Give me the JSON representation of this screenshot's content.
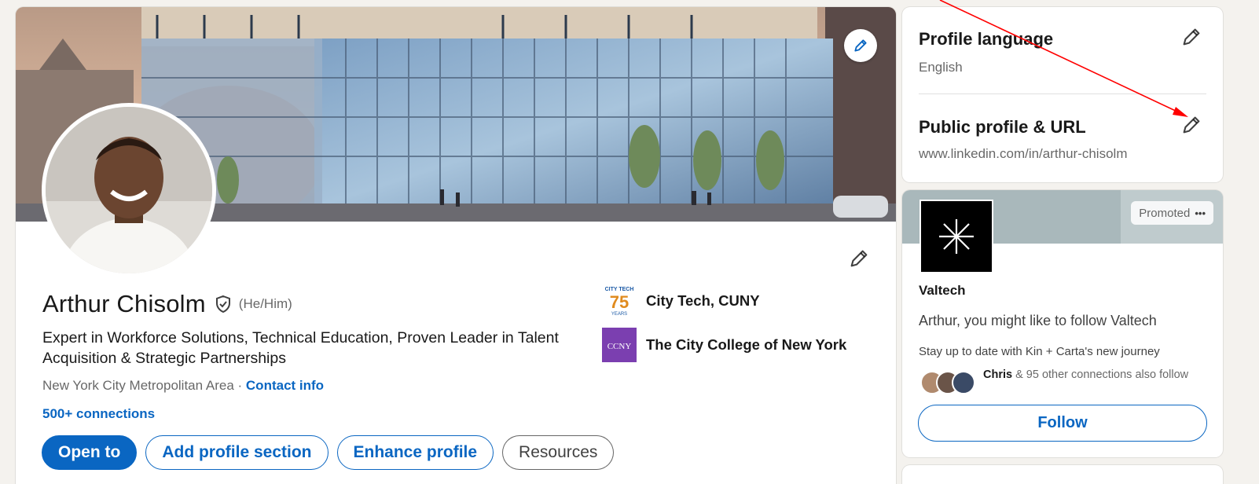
{
  "profile": {
    "name": "Arthur Chisolm",
    "pronouns": "(He/Him)",
    "headline": "Expert in Workforce Solutions, Technical Education, Proven Leader in Talent Acquisition & Strategic Partnerships",
    "location": "New York City Metropolitan Area",
    "location_separator": " · ",
    "contact_info": "Contact info",
    "connections": "500+ connections",
    "actions": {
      "open_to": "Open to",
      "add_section": "Add profile section",
      "enhance": "Enhance profile",
      "resources": "Resources"
    },
    "education": [
      {
        "name": "City Tech, CUNY",
        "logo_text": "CITY TECH",
        "logo_number": "75",
        "logo_sub": "YEARS"
      },
      {
        "name": "The City College of New York",
        "logo_text": "CCNY"
      }
    ]
  },
  "rail": {
    "language": {
      "title": "Profile language",
      "value": "English"
    },
    "public_url": {
      "title": "Public profile & URL",
      "value": "www.linkedin.com/in/arthur-chisolm"
    },
    "ad": {
      "promoted": "Promoted",
      "more": "•••",
      "company": "Valtech",
      "message": "Arthur, you might like to follow Valtech",
      "tagline": "Stay up to date with Kin + Carta's new journey",
      "connection_name": "Chris",
      "connection_rest": " & 95 other connections also follow",
      "follow": "Follow"
    }
  },
  "colors": {
    "brand_blue": "#0a66c2",
    "annotation_arrow": "#ff0000",
    "ccny_purple": "#7b3fb0"
  },
  "icons": [
    "pencil-icon",
    "verified-shield-icon",
    "sparkle-logo-icon",
    "ellipsis-icon"
  ]
}
